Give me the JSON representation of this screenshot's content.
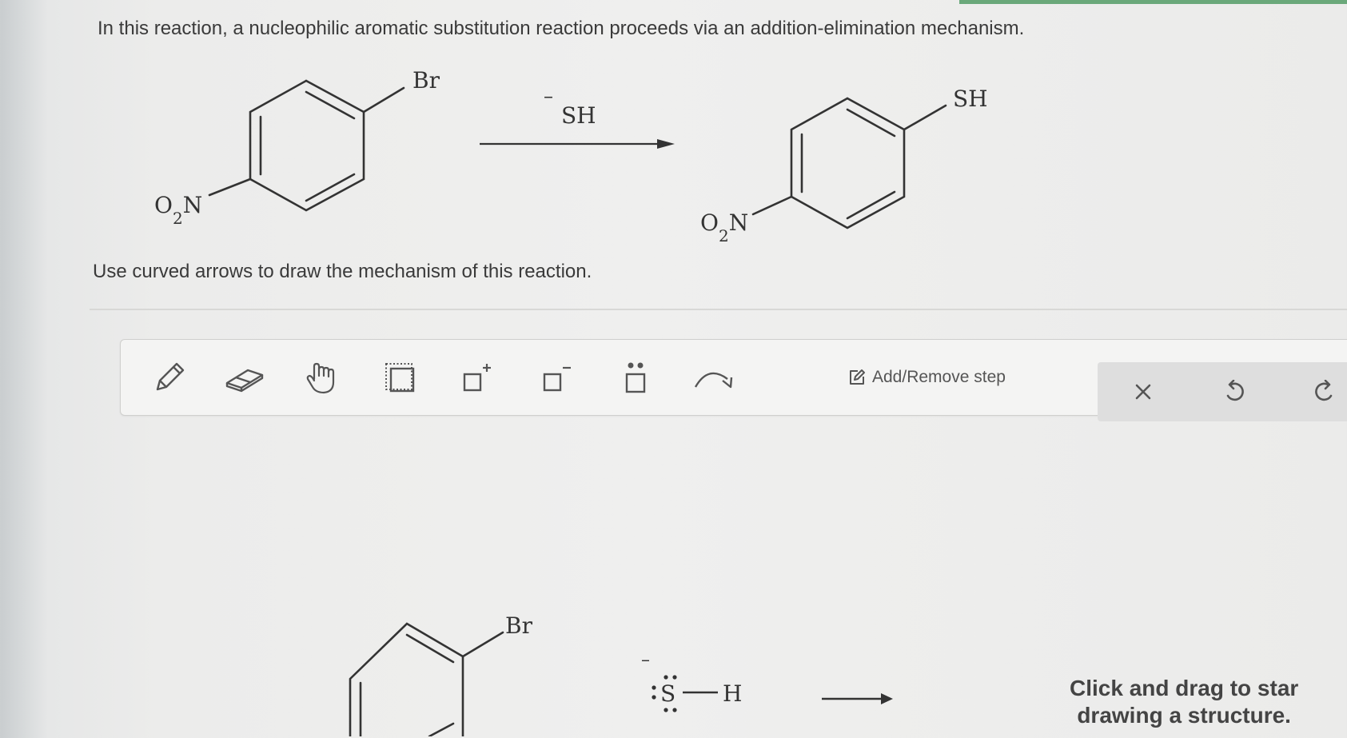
{
  "question": {
    "prompt": "In this reaction, a nucleophilic aromatic substitution reaction proceeds via an addition-elimination mechanism.",
    "instruction": "Use curved arrows to draw the mechanism of this reaction."
  },
  "reaction": {
    "reactant": {
      "substituent_top": "Br",
      "substituent_left_main": "O",
      "substituent_left_sub": "2",
      "substituent_left_tail": "N"
    },
    "reagent": {
      "charge": "–",
      "label": "SH"
    },
    "product": {
      "substituent_top": "SH",
      "substituent_left_main": "O",
      "substituent_left_sub": "2",
      "substituent_left_tail": "N"
    }
  },
  "toolbar": {
    "tools": [
      {
        "icon": "pencil-icon"
      },
      {
        "icon": "eraser-icon"
      },
      {
        "icon": "hand-icon"
      },
      {
        "icon": "selection-icon"
      },
      {
        "icon": "add-positive-charge-icon"
      },
      {
        "icon": "add-negative-charge-icon"
      },
      {
        "icon": "lone-pair-icon"
      },
      {
        "icon": "curved-arrow-icon"
      }
    ],
    "step_button": "Add/Remove step",
    "actions": {
      "clear": "clear-icon",
      "undo": "undo-icon",
      "redo": "redo-icon"
    }
  },
  "canvas": {
    "reactant_label": "Br",
    "nucleophile": {
      "charge": "–",
      "atom": "S",
      "partner": "H"
    },
    "hint_line1": "Click and drag to star",
    "hint_line2": "drawing a structure."
  }
}
